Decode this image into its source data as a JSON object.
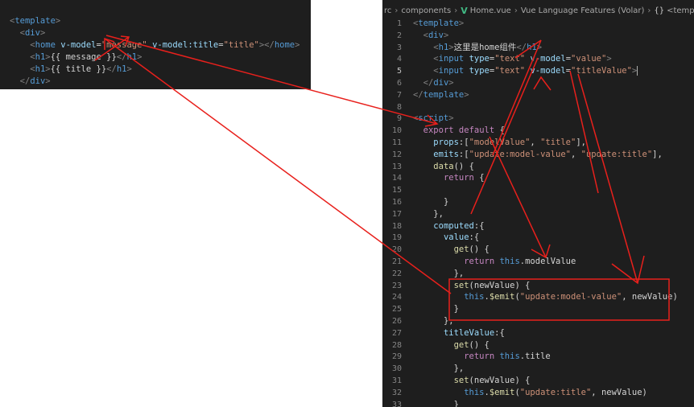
{
  "colors": {
    "annotation": "#e8201c",
    "editor_bg": "#1e1e1e",
    "vue_green": "#41b883"
  },
  "left_snippet": {
    "lines": [
      [
        "<",
        "template",
        ">"
      ],
      [
        "  ",
        "<",
        "div",
        ">"
      ],
      [
        "    ",
        "<",
        "home",
        " ",
        "v-model",
        "=",
        "\"message\"",
        " ",
        "v-model:title",
        "=",
        "\"title\"",
        "></",
        "home",
        ">"
      ],
      [
        "    ",
        "<",
        "h1",
        ">",
        "{{ message }}",
        "</",
        "h1",
        ">"
      ],
      [
        "    ",
        "<",
        "h1",
        ">",
        "{{ title }}",
        "</",
        "h1",
        ">"
      ],
      [
        "  ",
        "</",
        "div",
        ">"
      ],
      [
        "</",
        "template",
        ">"
      ]
    ]
  },
  "breadcrumb": {
    "items": [
      "rc",
      "components",
      "Home.vue",
      "Vue Language Features (Volar)",
      "<template>"
    ],
    "icons": [
      "vue-icon",
      "braces-icon"
    ]
  },
  "editor": {
    "lines": [
      {
        "n": "1",
        "text": "<template>"
      },
      {
        "n": "2",
        "text": "  <div>"
      },
      {
        "n": "3",
        "text": "    <h1>这里是home组件</h1>"
      },
      {
        "n": "4",
        "text": "    <input type=\"text\" v-model=\"value\">"
      },
      {
        "n": "5",
        "text": "    <input type=\"text\" v-model=\"titleValue\">"
      },
      {
        "n": "6",
        "text": "  </div>"
      },
      {
        "n": "7",
        "text": "</template>"
      },
      {
        "n": "8",
        "text": ""
      },
      {
        "n": "9",
        "text": "<script>"
      },
      {
        "n": "10",
        "text": "  export default {"
      },
      {
        "n": "11",
        "text": "    props:[\"modelValue\", \"title\"],"
      },
      {
        "n": "12",
        "text": "    emits:[\"update:model-value\", \"update:title\"],"
      },
      {
        "n": "13",
        "text": "    data() {"
      },
      {
        "n": "14",
        "text": "      return {"
      },
      {
        "n": "15",
        "text": ""
      },
      {
        "n": "16",
        "text": "      }"
      },
      {
        "n": "17",
        "text": "    },"
      },
      {
        "n": "18",
        "text": "    computed:{"
      },
      {
        "n": "19",
        "text": "      value:{"
      },
      {
        "n": "20",
        "text": "        get() {"
      },
      {
        "n": "21",
        "text": "          return this.modelValue"
      },
      {
        "n": "22",
        "text": "        },"
      },
      {
        "n": "23",
        "text": "        set(newValue) {"
      },
      {
        "n": "24",
        "text": "          this.$emit(\"update:model-value\", newValue)"
      },
      {
        "n": "25",
        "text": "        }"
      },
      {
        "n": "26",
        "text": "      },"
      },
      {
        "n": "27",
        "text": "      titleValue:{"
      },
      {
        "n": "28",
        "text": "        get() {"
      },
      {
        "n": "29",
        "text": "          return this.title"
      },
      {
        "n": "30",
        "text": "        },"
      },
      {
        "n": "31",
        "text": "        set(newValue) {"
      },
      {
        "n": "32",
        "text": "          this.$emit(\"update:title\", newValue)"
      },
      {
        "n": "33",
        "text": "        }"
      }
    ],
    "active_line": "5"
  }
}
